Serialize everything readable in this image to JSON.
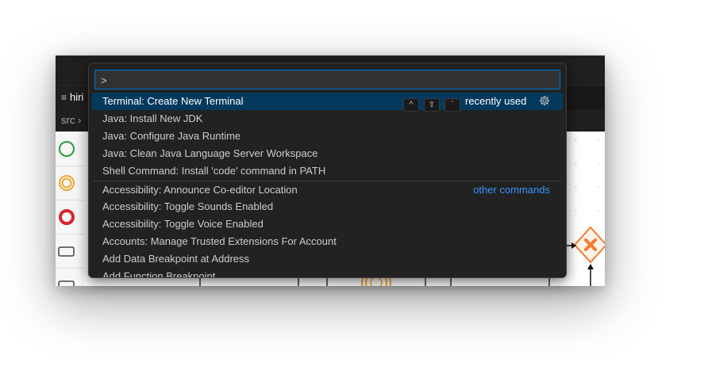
{
  "editor": {
    "tab_label": "hiri",
    "breadcrumb_root": "src",
    "breadcrumb_sep": "›"
  },
  "command_palette": {
    "input_value": ">",
    "items": [
      {
        "label": "Terminal: Create New Terminal",
        "selected": true,
        "tag": "recently used",
        "keybinding": [
          "^",
          "⇧",
          "`"
        ]
      },
      {
        "label": "Java: Install New JDK"
      },
      {
        "label": "Java: Configure Java Runtime"
      },
      {
        "label": "Java: Clean Java Language Server Workspace"
      },
      {
        "label": "Shell Command: Install 'code' command in PATH"
      },
      {
        "label": "Accessibility: Announce Co-editor Location",
        "tag": "other commands"
      },
      {
        "label": "Accessibility: Toggle Sounds Enabled"
      },
      {
        "label": "Accessibility: Toggle Voice Enabled"
      },
      {
        "label": "Accounts: Manage Trusted Extensions For Account"
      },
      {
        "label": "Add Data Breakpoint at Address"
      },
      {
        "label": "Add Function Breakpoint"
      }
    ]
  },
  "colors": {
    "selection": "#04395e",
    "link": "#3794ff",
    "focus_border": "#0078d4",
    "start_event": "#2e9b3e",
    "intermediate_event": "#f0a830",
    "end_event": "#d9262c",
    "gateway": "#f07a30"
  }
}
